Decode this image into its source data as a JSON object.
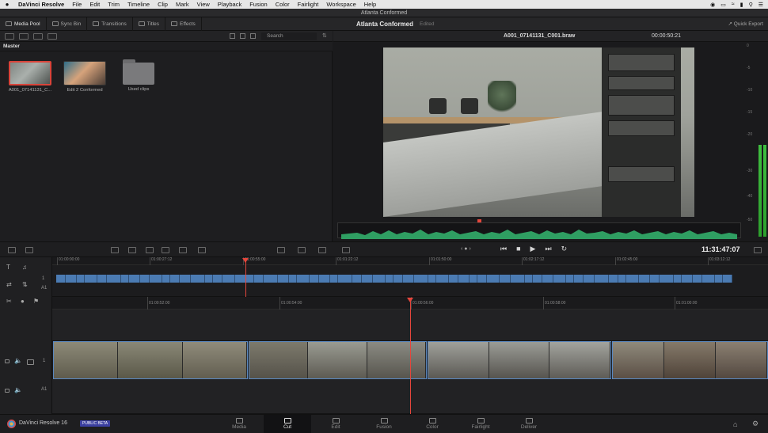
{
  "menubar": {
    "app": "DaVinci Resolve",
    "items": [
      "File",
      "Edit",
      "Trim",
      "Timeline",
      "Clip",
      "Mark",
      "View",
      "Playback",
      "Fusion",
      "Color",
      "Fairlight",
      "Workspace",
      "Help"
    ]
  },
  "window": {
    "title": "Atlanta Conformed"
  },
  "toolbar": {
    "buttons": [
      "Media Pool",
      "Sync Bin",
      "Transitions",
      "Titles",
      "Effects"
    ],
    "project_title": "Atlanta Conformed",
    "project_status": "Edited",
    "quick_export": "Quick Export"
  },
  "media_pool": {
    "search_label": "Search",
    "bin": "Master",
    "clips": [
      {
        "name": "A001_07141131_C..."
      },
      {
        "name": "Edit 2 Conformed"
      },
      {
        "name": "Used clips"
      }
    ]
  },
  "viewer": {
    "clip_name": "A001_07141131_C001.braw",
    "timecode": "00:00:50:21",
    "playhead_timecode": "11:31:47:07"
  },
  "meters": {
    "scale": [
      "0",
      "-5",
      "-10",
      "-15",
      "-20",
      "-30",
      "-40",
      "-50"
    ]
  },
  "upper_ruler": [
    "01:00:00:00",
    "01:00:27:12",
    "01:00:55:00",
    "01:01:22:12",
    "01:01:50:00",
    "01:02:17:12",
    "01:02:45:00",
    "01:03:12:12"
  ],
  "lower_ruler": [
    "01:00:52:00",
    "01:00:54:00",
    "01:00:56:00",
    "01:00:58:00",
    "01:01:00:00"
  ],
  "tracks": {
    "video": "1",
    "audio": "A1"
  },
  "pagebar": {
    "brand": "DaVinci Resolve 16",
    "badge": "PUBLIC BETA",
    "pages": [
      "Media",
      "Cut",
      "Edit",
      "Fusion",
      "Color",
      "Fairlight",
      "Deliver"
    ],
    "active_page": "Cut"
  },
  "colors": {
    "accent": "#e5463c",
    "clip_blue": "#4b7bb3",
    "meter_green": "#3fbf3f"
  }
}
